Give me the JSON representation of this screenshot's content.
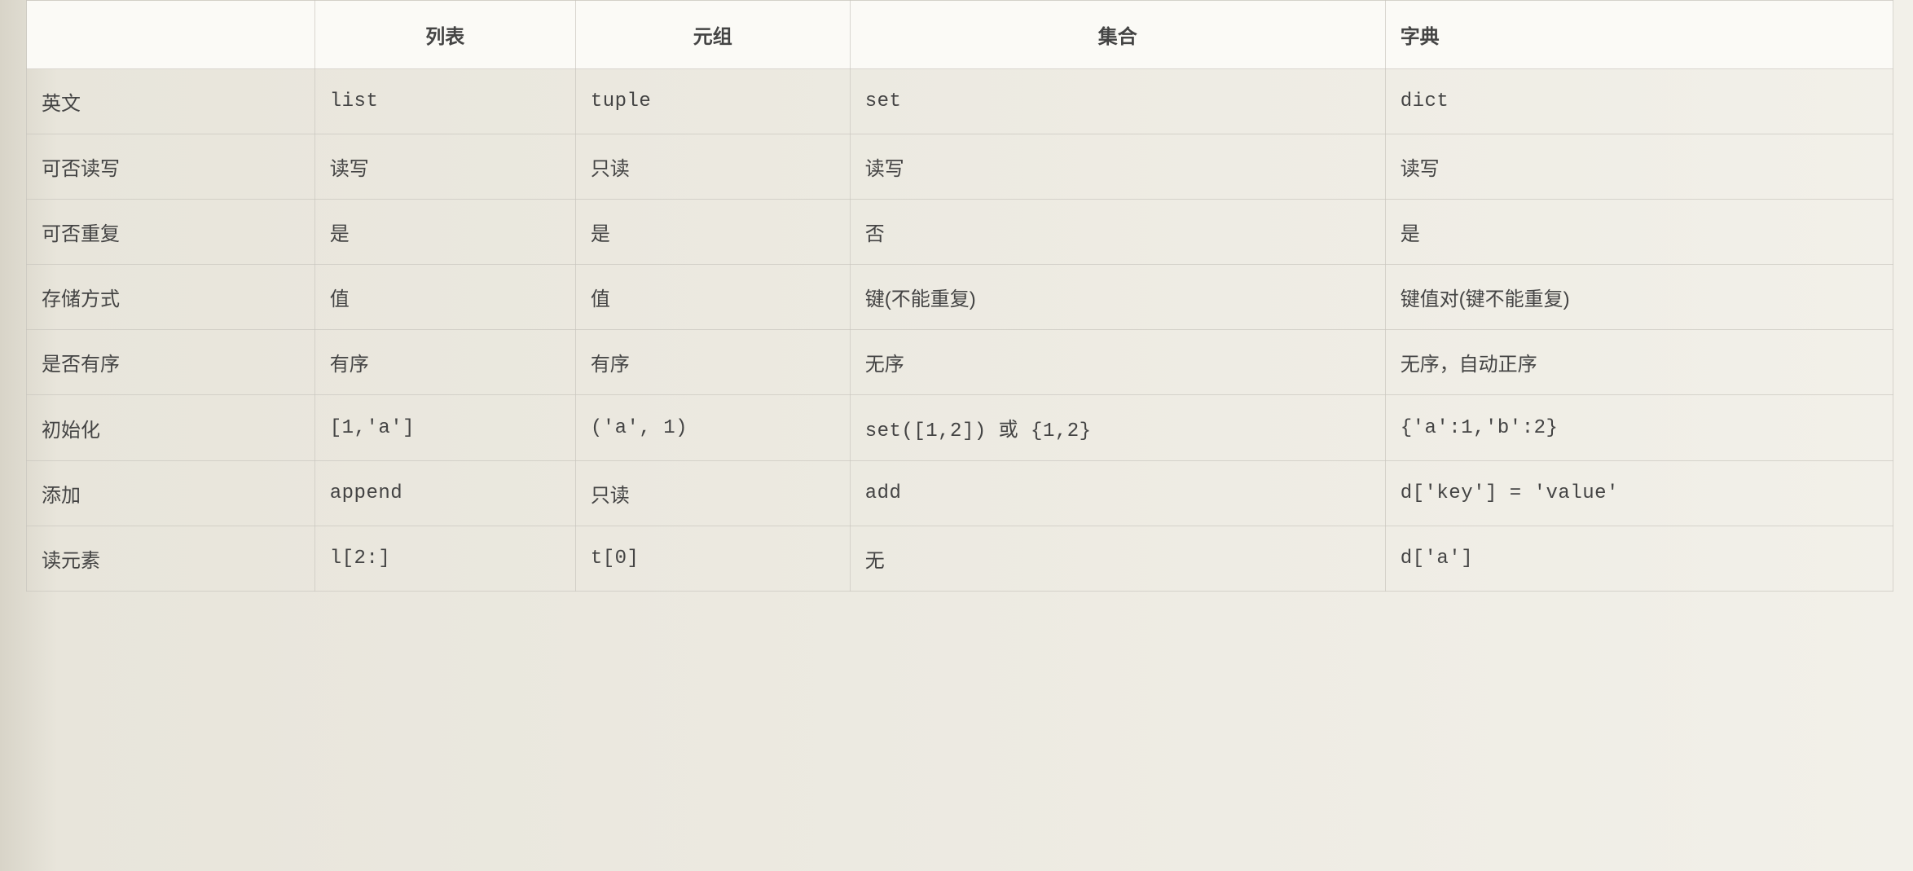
{
  "table": {
    "headers": [
      "",
      "列表",
      "元组",
      "集合",
      "字典"
    ],
    "rows": [
      {
        "label": "英文",
        "cells": [
          "list",
          "tuple",
          "set",
          "dict"
        ],
        "mono": [
          true,
          true,
          true,
          true
        ]
      },
      {
        "label": "可否读写",
        "cells": [
          "读写",
          "只读",
          "读写",
          "读写"
        ],
        "mono": [
          false,
          false,
          false,
          false
        ]
      },
      {
        "label": "可否重复",
        "cells": [
          "是",
          "是",
          "否",
          "是"
        ],
        "mono": [
          false,
          false,
          false,
          false
        ]
      },
      {
        "label": "存储方式",
        "cells": [
          "值",
          "值",
          "键(不能重复)",
          "键值对(键不能重复)"
        ],
        "mono": [
          false,
          false,
          false,
          false
        ]
      },
      {
        "label": "是否有序",
        "cells": [
          "有序",
          "有序",
          "无序",
          "无序，自动正序"
        ],
        "mono": [
          false,
          false,
          false,
          false
        ]
      },
      {
        "label": "初始化",
        "cells": [
          "[1,'a']",
          "('a', 1)",
          "set([1,2]) 或 {1,2}",
          "{'a':1,'b':2}"
        ],
        "mono": [
          true,
          true,
          true,
          true
        ]
      },
      {
        "label": "添加",
        "cells": [
          "append",
          "只读",
          "add",
          "d['key'] = 'value'"
        ],
        "mono": [
          true,
          false,
          true,
          true
        ]
      },
      {
        "label": "读元素",
        "cells": [
          "l[2:]",
          "t[0]",
          "无",
          "d['a']"
        ],
        "mono": [
          true,
          true,
          false,
          true
        ]
      }
    ]
  }
}
